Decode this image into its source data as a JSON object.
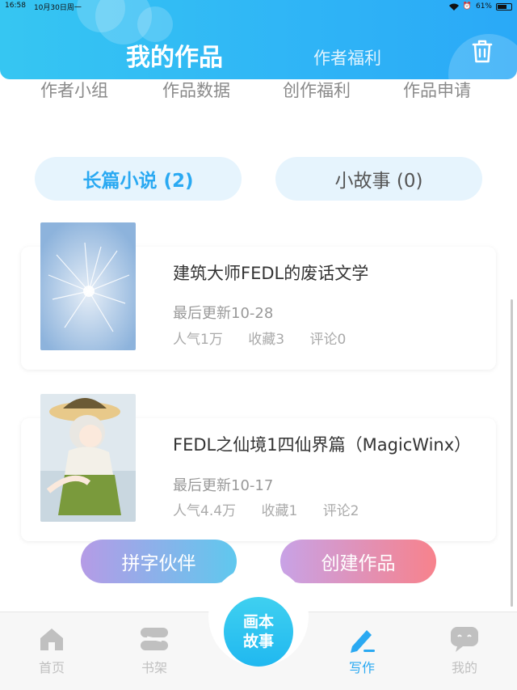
{
  "status_bar": {
    "time": "16:58",
    "date": "10月30日周一",
    "battery": "61%"
  },
  "header": {
    "title": "我的作品",
    "welfare": "作者福利"
  },
  "topnav": [
    "作者小组",
    "作品数据",
    "创作福利",
    "作品申请"
  ],
  "tabs": {
    "novel": "长篇小说 (2)",
    "story": "小故事 (0)"
  },
  "books": [
    {
      "title": "建筑大师FEDL的废话文学",
      "updated": "最后更新10-28",
      "popularity": "人气1万",
      "favorites": "收藏3",
      "comments": "评论0"
    },
    {
      "title": "FEDL之仙境1四仙界篇（MagicWinx）",
      "updated": "最后更新10-17",
      "popularity": "人气4.4万",
      "favorites": "收藏1",
      "comments": "评论2"
    }
  ],
  "actions": {
    "partner": "拼字伙伴",
    "create": "创建作品"
  },
  "bottom_nav": {
    "home": "首页",
    "shelf": "书架",
    "center_line1": "画本",
    "center_line2": "故事",
    "write": "写作",
    "mine": "我的"
  },
  "colors": {
    "primary": "#2aa9f2",
    "tab_bg": "#e6f4fd",
    "inactive_nav": "#c0c0c0"
  },
  "icons": {
    "trash": "trash-icon",
    "home": "home-icon",
    "shelf": "bookshelf-icon",
    "write": "pen-icon",
    "mine": "chat-bubble-icon"
  }
}
